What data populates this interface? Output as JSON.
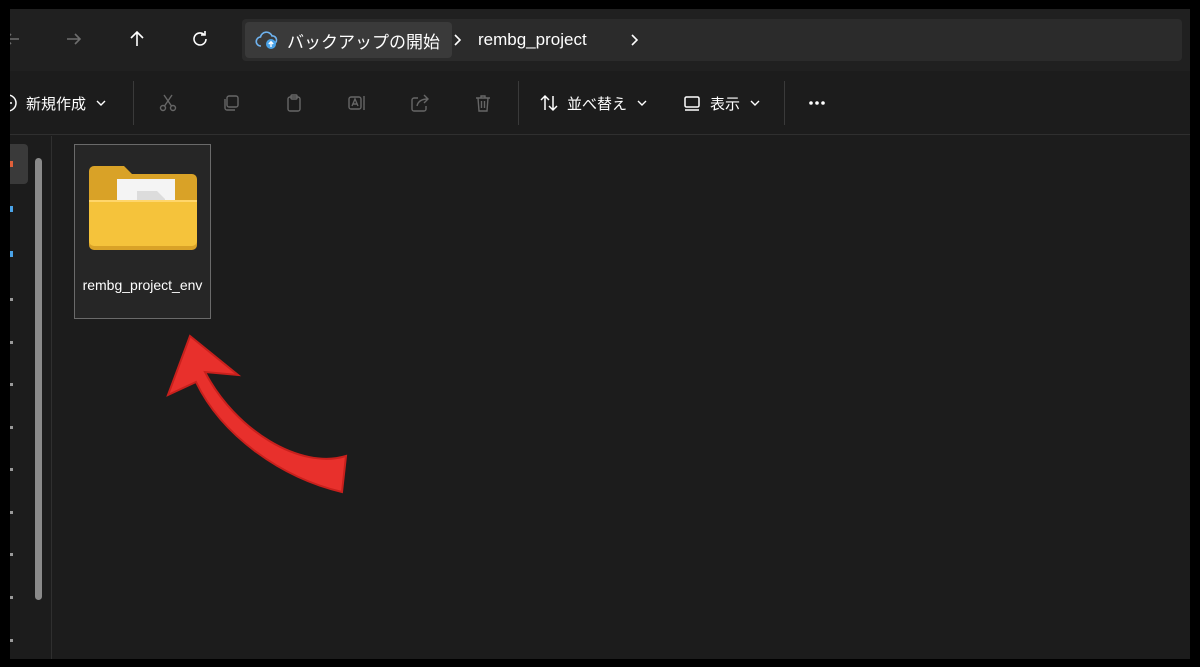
{
  "address_bar": {
    "breadcrumbs": [
      {
        "label": "バックアップの開始",
        "icon": "cloud-backup-icon"
      },
      {
        "label": "rembg_project"
      }
    ]
  },
  "toolbar": {
    "new_label": "新規作成",
    "sort_label": "並べ替え",
    "view_label": "表示",
    "icons": [
      "cut-icon",
      "copy-icon",
      "paste-icon",
      "rename-icon",
      "share-icon",
      "delete-icon",
      "more-icon"
    ]
  },
  "content": {
    "items": [
      {
        "name": "rembg_project_env",
        "type": "folder"
      }
    ]
  },
  "colors": {
    "background": "#1c1c1c",
    "folder": "#f5c33b",
    "arrow": "#e8302c",
    "accent": "#4aa3e8"
  }
}
